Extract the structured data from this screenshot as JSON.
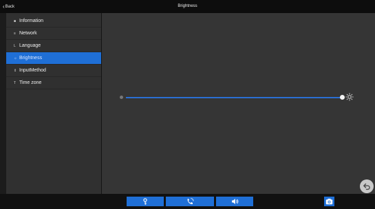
{
  "header": {
    "back_label": "Back",
    "title": "Brightness"
  },
  "sidebar": {
    "items": [
      {
        "label": "Information",
        "icon": "info-icon",
        "active": false
      },
      {
        "label": "Network",
        "icon": "network-icon",
        "active": false
      },
      {
        "label": "Language",
        "icon": "language-icon",
        "active": false
      },
      {
        "label": "Brightness",
        "icon": "brightness-icon",
        "active": true
      },
      {
        "label": "InputMethod",
        "icon": "input-method-icon",
        "active": false
      },
      {
        "label": "Time zone",
        "icon": "time-zone-icon",
        "active": false
      }
    ]
  },
  "brightness": {
    "level": 1.0
  },
  "bottom_bar": {
    "buttons": [
      "key-icon",
      "call-icon",
      "speaker-icon",
      "camera-icon"
    ]
  },
  "colors": {
    "accent": "#1f6fd6",
    "background": "#353535",
    "sidebar": "#303030",
    "titlebar": "#0d0d0d"
  }
}
